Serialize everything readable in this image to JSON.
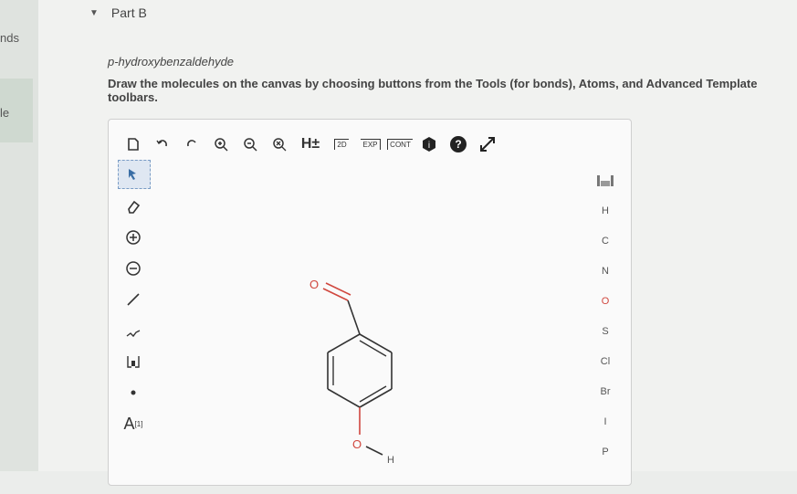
{
  "left_nav": {
    "item1": "nds",
    "item2": "le"
  },
  "part": {
    "title": "Part B"
  },
  "question": {
    "molecule": "p-hydroxybenzaldehyde",
    "instruction": "Draw the molecules on the canvas by choosing buttons from the Tools (for bonds), Atoms, and Advanced Template toolbars."
  },
  "toolbar_top": {
    "h_label": "H±",
    "label_2d": "2D",
    "exp_label": "EXP",
    "cont_label": "CONT"
  },
  "toolbar_left": {
    "text_tool": "A",
    "text_sup": "[1]"
  },
  "atoms": [
    "H",
    "C",
    "N",
    "O",
    "S",
    "Cl",
    "Br",
    "I",
    "P"
  ],
  "canvas": {
    "atom_O_top": "O",
    "atom_O_bottom": "O",
    "atom_H": "H"
  },
  "colors": {
    "oxygen": "#d0473e",
    "bond": "#333333"
  }
}
